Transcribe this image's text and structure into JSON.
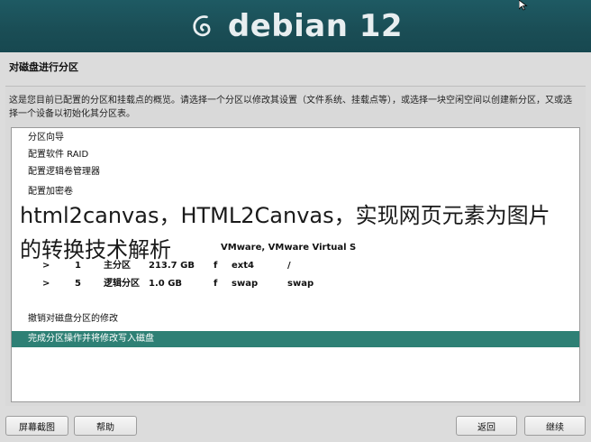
{
  "banner": {
    "brand": "debian 12",
    "logo_icon": "debian-swirl-icon"
  },
  "section_title": "对磁盘进行分区",
  "help_text": "这是您目前已配置的分区和挂载点的概览。请选择一个分区以修改其设置（文件系统、挂载点等），或选择一块空闲空间以创建新分区，又或选择一个设备以初始化其分区表。",
  "menu_top": [
    "分区向导",
    "配置软件 RAID",
    "配置逻辑卷管理器",
    "配置加密卷"
  ],
  "overlay": {
    "line1": "html2canvas，HTML2Canvas，实现网页元素为图片",
    "line2": "的转换技术解析"
  },
  "device_label_tail": "VMware, VMware Virtual S",
  "partitions": [
    {
      "marker": ">",
      "num": "1",
      "type": "主分区",
      "size": "213.7 GB",
      "flag": "f",
      "fs": "ext4",
      "mount": "/"
    },
    {
      "marker": ">",
      "num": "5",
      "type": "逻辑分区",
      "size": "1.0 GB",
      "flag": "f",
      "fs": "swap",
      "mount": "swap"
    }
  ],
  "menu_bottom": [
    "撤销对磁盘分区的修改",
    "完成分区操作并将修改写入磁盘"
  ],
  "buttons": {
    "screenshot": "屏幕截图",
    "help": "帮助",
    "back": "返回",
    "continue": "继续"
  },
  "colors": {
    "banner": "#1a4d55",
    "selected": "#2e8075"
  }
}
